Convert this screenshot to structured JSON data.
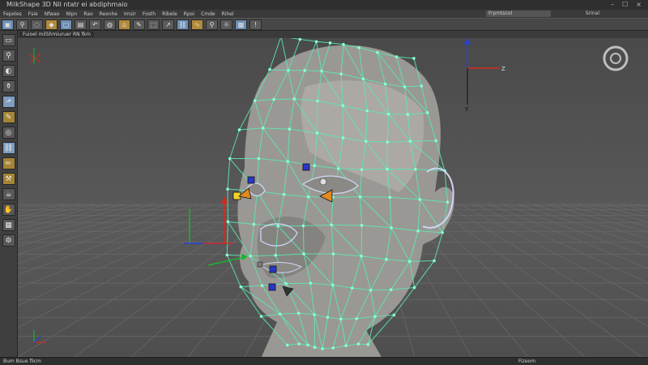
{
  "window": {
    "title": "MilkShape 3D",
    "subtitle": "Nil ntatr ei abdiphmaio",
    "controls": [
      "–",
      "☐",
      "×"
    ]
  },
  "menubar": {
    "items": [
      "Fepoles",
      "Fsie",
      "Nfwao",
      "Nlpn",
      "Rao",
      "Rexnhe",
      "Imsir",
      "Fosth",
      "Ribele",
      "Rpoi",
      "Cmde",
      "Rihel"
    ],
    "search_value": "Frpmtscol",
    "user_label": "Srinal"
  },
  "toolbar": {
    "buttons": [
      {
        "name": "select-icon",
        "glyph": "▣"
      },
      {
        "name": "magnify-icon",
        "glyph": "⚲"
      },
      {
        "name": "lasso-icon",
        "glyph": "◌"
      },
      {
        "name": "palette-icon",
        "glyph": "◆"
      },
      {
        "name": "box-icon",
        "glyph": "▢"
      },
      {
        "name": "folder-icon",
        "glyph": "▤"
      },
      {
        "name": "undo-icon",
        "glyph": "↶"
      },
      {
        "name": "sphere-icon",
        "glyph": "◍"
      },
      {
        "name": "home-icon",
        "glyph": "⌂"
      },
      {
        "name": "wrench-icon",
        "glyph": "✎"
      },
      {
        "name": "cube-icon",
        "glyph": "⬚"
      },
      {
        "name": "arrow-icon",
        "glyph": "↗"
      },
      {
        "name": "link-icon",
        "glyph": "⛓"
      },
      {
        "name": "wave-icon",
        "glyph": "∿"
      },
      {
        "name": "zoom-icon",
        "glyph": "⚲"
      },
      {
        "name": "light-icon",
        "glyph": "☼"
      },
      {
        "name": "render-icon",
        "glyph": "▩"
      },
      {
        "name": "help-icon",
        "glyph": "!"
      }
    ]
  },
  "viewport": {
    "tab_label": "Fuioel milShmiuruer RN fkm",
    "view_cube_label": "",
    "axis_labels": {
      "y": "Y",
      "z": "Z"
    }
  },
  "toolbox": {
    "tools": [
      {
        "name": "window-tool-icon",
        "glyph": "▭"
      },
      {
        "name": "magnet-tool-icon",
        "glyph": "⚲"
      },
      {
        "name": "sculpt-tool-icon",
        "glyph": "◐"
      },
      {
        "name": "vase-tool-icon",
        "glyph": "⚱"
      },
      {
        "name": "move-tool-icon",
        "glyph": "⬏",
        "active": true
      },
      {
        "name": "brush-tool-icon",
        "glyph": "✎",
        "warm": true
      },
      {
        "name": "ring-tool-icon",
        "glyph": "◎"
      },
      {
        "name": "chain-tool-icon",
        "glyph": "⛓",
        "active": true
      },
      {
        "name": "pencil-tool-icon",
        "glyph": "✏",
        "warm": true
      },
      {
        "name": "hammer-tool-icon",
        "glyph": "⚒",
        "warm": true
      },
      {
        "name": "cup-tool-icon",
        "glyph": "☕"
      },
      {
        "name": "hand-tool-icon",
        "glyph": "✋"
      },
      {
        "name": "grid-tool-icon",
        "glyph": "▦"
      },
      {
        "name": "gear-tool-icon",
        "glyph": "⚙"
      }
    ]
  },
  "statusbar": {
    "left": "Bum  Bsue flicm",
    "middle": "Fizeom",
    "right": ""
  },
  "colors": {
    "wireframe": "#5be8b2",
    "vertex": "#8dffd2",
    "marker_orange": "#e08a1f",
    "marker_blue": "#2a35c8",
    "marker_yellow": "#f0d22a",
    "axis_red": "#d42a1a",
    "axis_green": "#1fb12f",
    "axis_blue": "#2b3fd8"
  }
}
